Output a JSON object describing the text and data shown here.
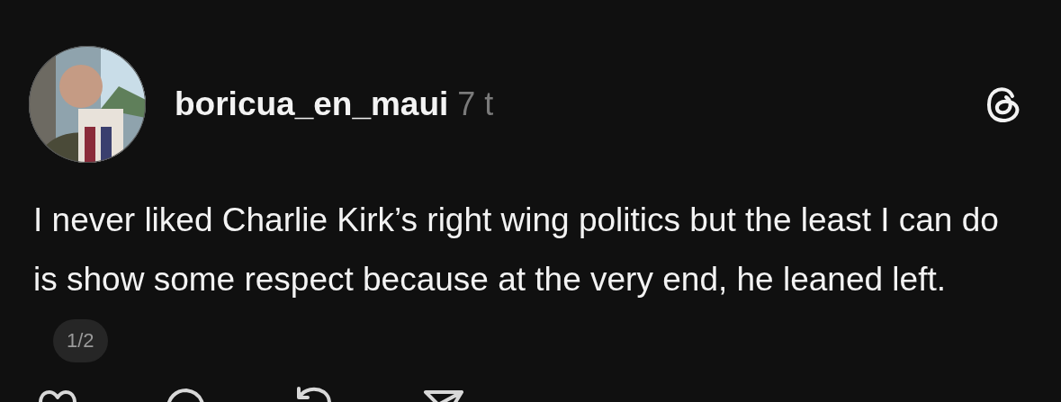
{
  "post": {
    "author": "boricua_en_maui",
    "time": "7 t",
    "text": "I never liked Charlie Kirk’s right wing politics but the least I can do is show some respect because at the very end, he leaned left.",
    "page_indicator": "1/2"
  }
}
